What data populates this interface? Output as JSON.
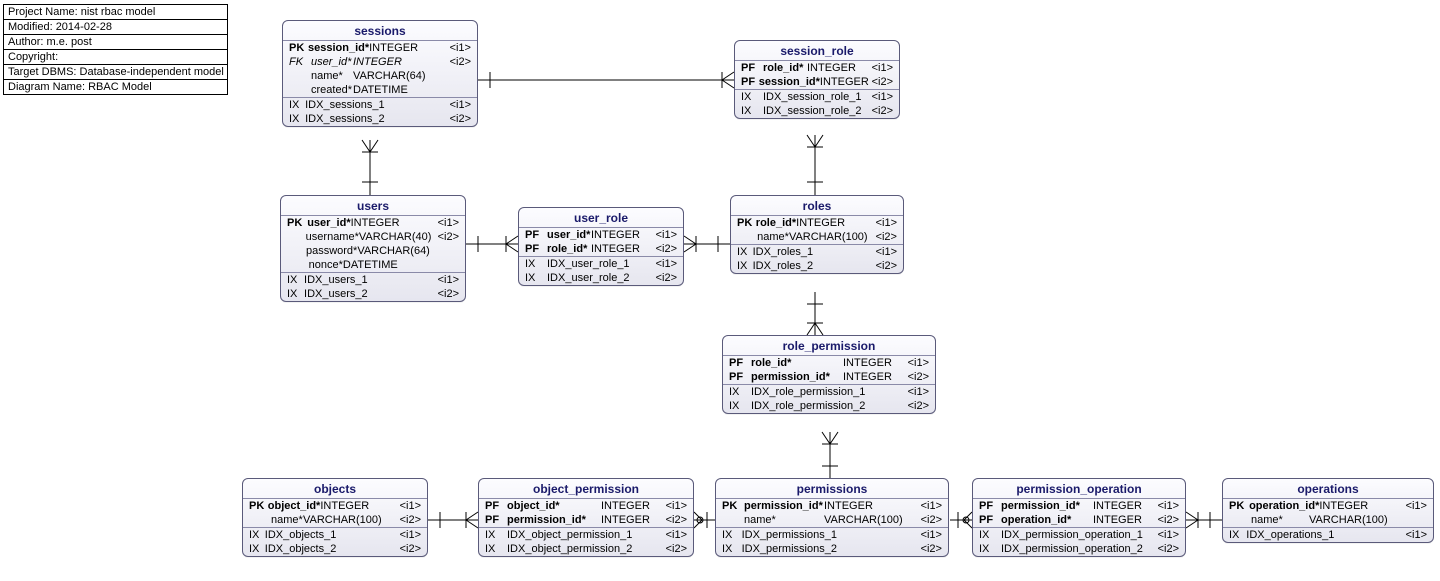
{
  "meta": {
    "rows": [
      "Project Name: nist rbac model",
      "Modified: 2014-02-28",
      "Author: m.e. post",
      "Copyright:",
      "Target DBMS: Database-independent model",
      "Diagram Name: RBAC Model"
    ]
  },
  "entities": {
    "sessions": {
      "title": "sessions",
      "cols": [
        {
          "key": "PK",
          "name": "session_id*",
          "type": "INTEGER",
          "tag": "<i1>",
          "bold": true
        },
        {
          "key": "FK",
          "name": "user_id*",
          "type": "INTEGER",
          "tag": "<i2>",
          "ital": true
        },
        {
          "key": "",
          "name": "name*",
          "type": "VARCHAR(64)",
          "tag": "",
          "plain": true
        },
        {
          "key": "",
          "name": "created*",
          "type": "DATETIME",
          "tag": "",
          "plain": true
        }
      ],
      "idx": [
        {
          "key": "IX",
          "name": "IDX_sessions_1",
          "tag": "<i1>"
        },
        {
          "key": "IX",
          "name": "IDX_sessions_2",
          "tag": "<i2>"
        }
      ]
    },
    "session_role": {
      "title": "session_role",
      "cols": [
        {
          "key": "PF",
          "name": "role_id*",
          "type": "INTEGER",
          "tag": "<i1>",
          "bold": true
        },
        {
          "key": "PF",
          "name": "session_id*",
          "type": "INTEGER",
          "tag": "<i2>",
          "bold": true
        }
      ],
      "idx": [
        {
          "key": "IX",
          "name": "IDX_session_role_1",
          "tag": "<i1>"
        },
        {
          "key": "IX",
          "name": "IDX_session_role_2",
          "tag": "<i2>"
        }
      ]
    },
    "users": {
      "title": "users",
      "cols": [
        {
          "key": "PK",
          "name": "user_id*",
          "type": "INTEGER",
          "tag": "<i1>",
          "bold": true
        },
        {
          "key": "",
          "name": "username*",
          "type": "VARCHAR(40)",
          "tag": "<i2>",
          "plain": true
        },
        {
          "key": "",
          "name": "password*",
          "type": "VARCHAR(64)",
          "tag": "",
          "plain": true
        },
        {
          "key": "",
          "name": "nonce*",
          "type": "DATETIME",
          "tag": "",
          "plain": true
        }
      ],
      "idx": [
        {
          "key": "IX",
          "name": "IDX_users_1",
          "tag": "<i1>"
        },
        {
          "key": "IX",
          "name": "IDX_users_2",
          "tag": "<i2>"
        }
      ]
    },
    "user_role": {
      "title": "user_role",
      "cols": [
        {
          "key": "PF",
          "name": "user_id*",
          "type": "INTEGER",
          "tag": "<i1>",
          "bold": true
        },
        {
          "key": "PF",
          "name": "role_id*",
          "type": "INTEGER",
          "tag": "<i2>",
          "bold": true
        }
      ],
      "idx": [
        {
          "key": "IX",
          "name": "IDX_user_role_1",
          "tag": "<i1>"
        },
        {
          "key": "IX",
          "name": "IDX_user_role_2",
          "tag": "<i2>"
        }
      ]
    },
    "roles": {
      "title": "roles",
      "cols": [
        {
          "key": "PK",
          "name": "role_id*",
          "type": "INTEGER",
          "tag": "<i1>",
          "bold": true
        },
        {
          "key": "",
          "name": "name*",
          "type": "VARCHAR(100)",
          "tag": "<i2>",
          "plain": true
        }
      ],
      "idx": [
        {
          "key": "IX",
          "name": "IDX_roles_1",
          "tag": "<i1>"
        },
        {
          "key": "IX",
          "name": "IDX_roles_2",
          "tag": "<i2>"
        }
      ]
    },
    "role_permission": {
      "title": "role_permission",
      "cols": [
        {
          "key": "PF",
          "name": "role_id*",
          "type": "INTEGER",
          "tag": "<i1>",
          "bold": true
        },
        {
          "key": "PF",
          "name": "permission_id*",
          "type": "INTEGER",
          "tag": "<i2>",
          "bold": true
        }
      ],
      "idx": [
        {
          "key": "IX",
          "name": "IDX_role_permission_1",
          "tag": "<i1>"
        },
        {
          "key": "IX",
          "name": "IDX_role_permission_2",
          "tag": "<i2>"
        }
      ]
    },
    "objects": {
      "title": "objects",
      "cols": [
        {
          "key": "PK",
          "name": "object_id*",
          "type": "INTEGER",
          "tag": "<i1>",
          "bold": true
        },
        {
          "key": "",
          "name": "name*",
          "type": "VARCHAR(100)",
          "tag": "<i2>",
          "plain": true
        }
      ],
      "idx": [
        {
          "key": "IX",
          "name": "IDX_objects_1",
          "tag": "<i1>"
        },
        {
          "key": "IX",
          "name": "IDX_objects_2",
          "tag": "<i2>"
        }
      ]
    },
    "object_permission": {
      "title": "object_permission",
      "cols": [
        {
          "key": "PF",
          "name": "object_id*",
          "type": "INTEGER",
          "tag": "<i1>",
          "bold": true
        },
        {
          "key": "PF",
          "name": "permission_id*",
          "type": "INTEGER",
          "tag": "<i2>",
          "bold": true
        }
      ],
      "idx": [
        {
          "key": "IX",
          "name": "IDX_object_permission_1",
          "tag": "<i1>"
        },
        {
          "key": "IX",
          "name": "IDX_object_permission_2",
          "tag": "<i2>"
        }
      ]
    },
    "permissions": {
      "title": "permissions",
      "cols": [
        {
          "key": "PK",
          "name": "permission_id*",
          "type": "INTEGER",
          "tag": "<i1>",
          "bold": true
        },
        {
          "key": "",
          "name": "name*",
          "type": "VARCHAR(100)",
          "tag": "<i2>",
          "plain": true
        }
      ],
      "idx": [
        {
          "key": "IX",
          "name": "IDX_permissions_1",
          "tag": "<i1>"
        },
        {
          "key": "IX",
          "name": "IDX_permissions_2",
          "tag": "<i2>"
        }
      ]
    },
    "permission_operation": {
      "title": "permission_operation",
      "cols": [
        {
          "key": "PF",
          "name": "permission_id*",
          "type": "INTEGER",
          "tag": "<i1>",
          "bold": true
        },
        {
          "key": "PF",
          "name": "operation_id*",
          "type": "INTEGER",
          "tag": "<i2>",
          "bold": true
        }
      ],
      "idx": [
        {
          "key": "IX",
          "name": "IDX_permission_operation_1",
          "tag": "<i1>"
        },
        {
          "key": "IX",
          "name": "IDX_permission_operation_2",
          "tag": "<i2>"
        }
      ]
    },
    "operations": {
      "title": "operations",
      "cols": [
        {
          "key": "PK",
          "name": "operation_id*",
          "type": "INTEGER",
          "tag": "<i1>",
          "bold": true
        },
        {
          "key": "",
          "name": "name*",
          "type": "VARCHAR(100)",
          "tag": "",
          "plain": true
        }
      ],
      "idx": [
        {
          "key": "IX",
          "name": "IDX_operations_1",
          "tag": "<i1>"
        }
      ]
    }
  }
}
